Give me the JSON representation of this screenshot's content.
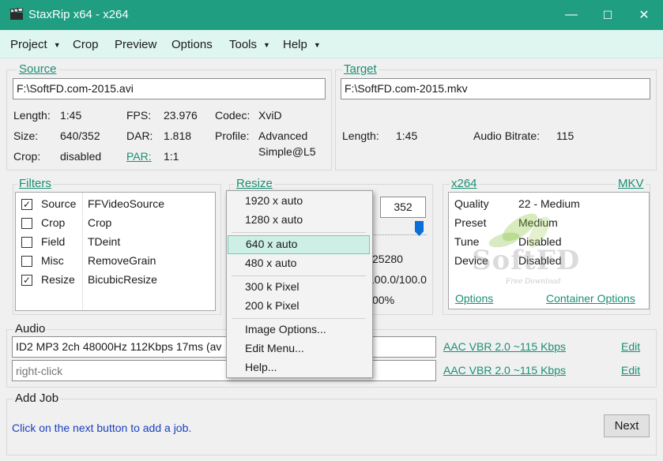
{
  "window": {
    "title": "StaxRip x64 - x264",
    "minimize": "—",
    "maximize": "☐",
    "close": "✕"
  },
  "menu": {
    "project": "Project",
    "crop": "Crop",
    "preview": "Preview",
    "options": "Options",
    "tools": "Tools",
    "help": "Help"
  },
  "source": {
    "label": "Source",
    "path": "F:\\SoftFD.com-2015.avi",
    "length_label": "Length:",
    "length": "1:45",
    "size_label": "Size:",
    "size": "640/352",
    "crop_label": "Crop:",
    "crop": "disabled",
    "fps_label": "FPS:",
    "fps": "23.976",
    "dar_label": "DAR:",
    "dar": "1.818",
    "par_label": "PAR:",
    "par": "1:1",
    "codec_label": "Codec:",
    "codec": "XviD",
    "profile_label": "Profile:",
    "profile_line1": "Advanced",
    "profile_line2": "Simple@L5"
  },
  "target": {
    "label": "Target",
    "path": "F:\\SoftFD.com-2015.mkv",
    "length_label": "Length:",
    "length": "1:45",
    "audio_bitrate_label": "Audio Bitrate:",
    "audio_bitrate": "115"
  },
  "filters": {
    "label": "Filters",
    "items": [
      {
        "category": "Source",
        "name": "FFVideoSource",
        "checked": true
      },
      {
        "category": "Crop",
        "name": "Crop",
        "checked": false
      },
      {
        "category": "Field",
        "name": "TDeint",
        "checked": false
      },
      {
        "category": "Misc",
        "name": "RemoveGrain",
        "checked": false
      },
      {
        "category": "Resize",
        "name": "BicubicResize",
        "checked": true
      }
    ]
  },
  "resize": {
    "label": "Resize",
    "height_value": "352",
    "value_1": "25280",
    "value_2": "100.0/100.0",
    "value_3": "00%"
  },
  "resize_menu": {
    "items": [
      "1920 x auto",
      "1280 x auto",
      "640 x auto",
      "480 x auto",
      "300 k Pixel",
      "200 k Pixel",
      "Image Options...",
      "Edit Menu...",
      "Help..."
    ],
    "highlighted_index": 2
  },
  "encoder": {
    "label": "x264",
    "container_label": "MKV",
    "rows": [
      {
        "key": "Quality",
        "value": "22 - Medium"
      },
      {
        "key": "Preset",
        "value": "Medium"
      },
      {
        "key": "Tune",
        "value": "Disabled"
      },
      {
        "key": "Device",
        "value": "Disabled"
      }
    ],
    "options_link": "Options",
    "container_options_link": "Container Options"
  },
  "watermark": {
    "brand": "SoftFD",
    "sub": "Free Download"
  },
  "audio": {
    "label": "Audio",
    "track1": "ID2 MP3 2ch 48000Hz 112Kbps 17ms (av",
    "track1_codec": "AAC VBR 2.0 ~115 Kbps",
    "track1_edit": "Edit",
    "track2_placeholder": "right-click",
    "track2_codec": "AAC VBR 2.0 ~115 Kbps",
    "track2_edit": "Edit"
  },
  "add_job": {
    "label": "Add Job",
    "hint": "Click on the next button to add a job.",
    "next_button": "Next"
  },
  "colors": {
    "titlebar": "#1f9e82",
    "menubar": "#dff6f0",
    "link": "#1a8f73",
    "hint": "#1a3fbf",
    "highlight": "#cdefe6"
  }
}
